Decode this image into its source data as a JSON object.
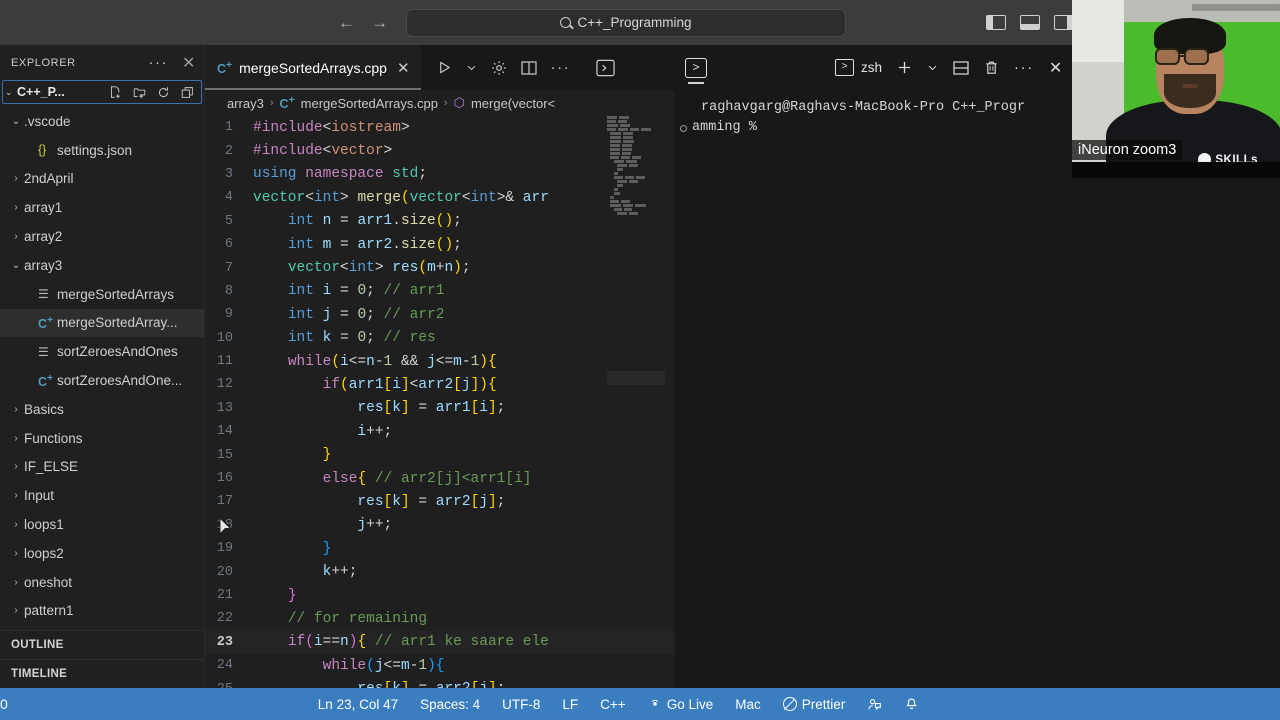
{
  "titlebar": {
    "back_icon": "←",
    "forward_icon": "→",
    "search_value": "C++_Programming",
    "search_icon": "search-icon",
    "layout_icons": [
      "toggle-primary-sidebar",
      "toggle-panel",
      "toggle-secondary-sidebar",
      "customize-layout"
    ]
  },
  "sidebar": {
    "title": "EXPLORER",
    "more_actions": "···",
    "close": "✕",
    "root": {
      "name": "C++_P...",
      "chevron": "⌄"
    },
    "root_actions": [
      "new-file",
      "new-folder",
      "refresh-explorer",
      "collapse-folders"
    ],
    "tree": [
      {
        "label": ".vscode",
        "indent": 0,
        "type": "folder",
        "open": true,
        "selected": false
      },
      {
        "label": "settings.json",
        "indent": 1,
        "type": "json",
        "open": false,
        "selected": false
      },
      {
        "label": "2ndApril",
        "indent": 0,
        "type": "folder",
        "open": false,
        "selected": false
      },
      {
        "label": "array1",
        "indent": 0,
        "type": "folder",
        "open": false,
        "selected": false
      },
      {
        "label": "array2",
        "indent": 0,
        "type": "folder",
        "open": false,
        "selected": false
      },
      {
        "label": "array3",
        "indent": 0,
        "type": "folder",
        "open": true,
        "selected": false
      },
      {
        "label": "mergeSortedArrays",
        "indent": 1,
        "type": "exe",
        "open": false,
        "selected": false
      },
      {
        "label": "mergeSortedArray...",
        "indent": 1,
        "type": "cpp",
        "open": false,
        "selected": true
      },
      {
        "label": "sortZeroesAndOnes",
        "indent": 1,
        "type": "exe",
        "open": false,
        "selected": false
      },
      {
        "label": "sortZeroesAndOne...",
        "indent": 1,
        "type": "cpp",
        "open": false,
        "selected": false
      },
      {
        "label": "Basics",
        "indent": 0,
        "type": "folder",
        "open": false,
        "selected": false
      },
      {
        "label": "Functions",
        "indent": 0,
        "type": "folder",
        "open": false,
        "selected": false
      },
      {
        "label": "IF_ELSE",
        "indent": 0,
        "type": "folder",
        "open": false,
        "selected": false
      },
      {
        "label": "Input",
        "indent": 0,
        "type": "folder",
        "open": false,
        "selected": false
      },
      {
        "label": "loops1",
        "indent": 0,
        "type": "folder",
        "open": false,
        "selected": false
      },
      {
        "label": "loops2",
        "indent": 0,
        "type": "folder",
        "open": false,
        "selected": false
      },
      {
        "label": "oneshot",
        "indent": 0,
        "type": "folder",
        "open": false,
        "selected": false
      },
      {
        "label": "pattern1",
        "indent": 0,
        "type": "folder",
        "open": false,
        "selected": false
      }
    ],
    "outline_label": "OUTLINE",
    "timeline_label": "TIMELINE"
  },
  "editor": {
    "tab": {
      "label": "mergeSortedArrays.cpp",
      "icon": "cpp-file-icon",
      "close": "✕"
    },
    "actions": [
      "run-code-button",
      "run-dropdown-chevron",
      "settings-gear-icon",
      "split-editor-icon",
      "more-actions-icon",
      "toggle-terminal-icon"
    ],
    "breadcrumb": [
      "array3",
      "mergeSortedArrays.cpp",
      "merge(vector<"
    ],
    "breadcrumb_separator": "›",
    "active_line": 23,
    "code": [
      {
        "n": 1,
        "tokens": [
          [
            "pre",
            "#include"
          ],
          [
            "op",
            "<"
          ],
          [
            "str",
            "iostream"
          ],
          [
            "op",
            ">"
          ]
        ]
      },
      {
        "n": 2,
        "tokens": [
          [
            "pre",
            "#include"
          ],
          [
            "op",
            "<"
          ],
          [
            "str",
            "vector"
          ],
          [
            "op",
            ">"
          ]
        ]
      },
      {
        "n": 3,
        "tokens": [
          [
            "kw",
            "using "
          ],
          [
            "ctl",
            "namespace "
          ],
          [
            "typ",
            "std"
          ],
          [
            "op",
            ";"
          ]
        ]
      },
      {
        "n": 4,
        "tokens": [
          [
            "typ",
            "vector"
          ],
          [
            "op",
            "<"
          ],
          [
            "kw",
            "int"
          ],
          [
            "op",
            "> "
          ],
          [
            "fn",
            "merge"
          ],
          [
            "p1",
            "("
          ],
          [
            "typ",
            "vector"
          ],
          [
            "op",
            "<"
          ],
          [
            "kw",
            "int"
          ],
          [
            "op",
            ">& "
          ],
          [
            "var",
            "arr"
          ]
        ]
      },
      {
        "n": 5,
        "tokens": [
          [
            "op",
            "    "
          ],
          [
            "kw",
            "int "
          ],
          [
            "var",
            "n"
          ],
          [
            "op",
            " = "
          ],
          [
            "var",
            "arr1"
          ],
          [
            "op",
            "."
          ],
          [
            "fn",
            "size"
          ],
          [
            "p1",
            "()"
          ],
          [
            "op",
            ";"
          ]
        ]
      },
      {
        "n": 6,
        "tokens": [
          [
            "op",
            "    "
          ],
          [
            "kw",
            "int "
          ],
          [
            "var",
            "m"
          ],
          [
            "op",
            " = "
          ],
          [
            "var",
            "arr2"
          ],
          [
            "op",
            "."
          ],
          [
            "fn",
            "size"
          ],
          [
            "p1",
            "()"
          ],
          [
            "op",
            ";"
          ]
        ]
      },
      {
        "n": 7,
        "tokens": [
          [
            "op",
            "    "
          ],
          [
            "typ",
            "vector"
          ],
          [
            "op",
            "<"
          ],
          [
            "kw",
            "int"
          ],
          [
            "op",
            "> "
          ],
          [
            "var",
            "res"
          ],
          [
            "p1",
            "("
          ],
          [
            "var",
            "m"
          ],
          [
            "op",
            "+"
          ],
          [
            "var",
            "n"
          ],
          [
            "p1",
            ")"
          ],
          [
            "op",
            ";"
          ]
        ]
      },
      {
        "n": 8,
        "tokens": [
          [
            "op",
            "    "
          ],
          [
            "kw",
            "int "
          ],
          [
            "var",
            "i"
          ],
          [
            "op",
            " = "
          ],
          [
            "num",
            "0"
          ],
          [
            "op",
            "; "
          ],
          [
            "cmt",
            "// arr1"
          ]
        ]
      },
      {
        "n": 9,
        "tokens": [
          [
            "op",
            "    "
          ],
          [
            "kw",
            "int "
          ],
          [
            "var",
            "j"
          ],
          [
            "op",
            " = "
          ],
          [
            "num",
            "0"
          ],
          [
            "op",
            "; "
          ],
          [
            "cmt",
            "// arr2"
          ]
        ]
      },
      {
        "n": 10,
        "tokens": [
          [
            "op",
            "    "
          ],
          [
            "kw",
            "int "
          ],
          [
            "var",
            "k"
          ],
          [
            "op",
            " = "
          ],
          [
            "num",
            "0"
          ],
          [
            "op",
            "; "
          ],
          [
            "cmt",
            "// res"
          ]
        ]
      },
      {
        "n": 11,
        "tokens": [
          [
            "op",
            "    "
          ],
          [
            "ctl",
            "while"
          ],
          [
            "p1",
            "("
          ],
          [
            "var",
            "i"
          ],
          [
            "op",
            "<="
          ],
          [
            "var",
            "n"
          ],
          [
            "op",
            "-"
          ],
          [
            "num",
            "1"
          ],
          [
            "op",
            " && "
          ],
          [
            "var",
            "j"
          ],
          [
            "op",
            "<="
          ],
          [
            "var",
            "m"
          ],
          [
            "op",
            "-"
          ],
          [
            "num",
            "1"
          ],
          [
            "p1",
            ")"
          ],
          [
            "p1",
            "{"
          ]
        ]
      },
      {
        "n": 12,
        "tokens": [
          [
            "op",
            "        "
          ],
          [
            "ctl",
            "if"
          ],
          [
            "p1",
            "("
          ],
          [
            "var",
            "arr1"
          ],
          [
            "p1",
            "["
          ],
          [
            "var",
            "i"
          ],
          [
            "p1",
            "]"
          ],
          [
            "op",
            "<"
          ],
          [
            "var",
            "arr2"
          ],
          [
            "p1",
            "["
          ],
          [
            "var",
            "j"
          ],
          [
            "p1",
            "]"
          ],
          [
            "p1",
            ")"
          ],
          [
            "p1",
            "{"
          ]
        ]
      },
      {
        "n": 13,
        "tokens": [
          [
            "op",
            "            "
          ],
          [
            "var",
            "res"
          ],
          [
            "p1",
            "["
          ],
          [
            "var",
            "k"
          ],
          [
            "p1",
            "]"
          ],
          [
            "op",
            " = "
          ],
          [
            "var",
            "arr1"
          ],
          [
            "p1",
            "["
          ],
          [
            "var",
            "i"
          ],
          [
            "p1",
            "]"
          ],
          [
            "op",
            ";"
          ]
        ]
      },
      {
        "n": 14,
        "tokens": [
          [
            "op",
            "            "
          ],
          [
            "var",
            "i"
          ],
          [
            "op",
            "++;"
          ]
        ]
      },
      {
        "n": 15,
        "tokens": [
          [
            "op",
            "        "
          ],
          [
            "p1",
            "}"
          ]
        ]
      },
      {
        "n": 16,
        "tokens": [
          [
            "op",
            "        "
          ],
          [
            "ctl",
            "else"
          ],
          [
            "p1",
            "{"
          ],
          [
            "op",
            " "
          ],
          [
            "cmt",
            "// arr2[j]<arr1[i]"
          ]
        ]
      },
      {
        "n": 17,
        "tokens": [
          [
            "op",
            "            "
          ],
          [
            "var",
            "res"
          ],
          [
            "p1",
            "["
          ],
          [
            "var",
            "k"
          ],
          [
            "p1",
            "]"
          ],
          [
            "op",
            " = "
          ],
          [
            "var",
            "arr2"
          ],
          [
            "p1",
            "["
          ],
          [
            "var",
            "j"
          ],
          [
            "p1",
            "]"
          ],
          [
            "op",
            ";"
          ]
        ]
      },
      {
        "n": 18,
        "tokens": [
          [
            "op",
            "            "
          ],
          [
            "var",
            "j"
          ],
          [
            "op",
            "++;"
          ]
        ]
      },
      {
        "n": 19,
        "tokens": [
          [
            "op",
            "        "
          ],
          [
            "p3",
            "}"
          ]
        ]
      },
      {
        "n": 20,
        "tokens": [
          [
            "op",
            "        "
          ],
          [
            "var",
            "k"
          ],
          [
            "op",
            "++;"
          ]
        ]
      },
      {
        "n": 21,
        "tokens": [
          [
            "op",
            "    "
          ],
          [
            "p2",
            "}"
          ]
        ]
      },
      {
        "n": 22,
        "tokens": [
          [
            "op",
            "    "
          ],
          [
            "cmt",
            "// for remaining"
          ]
        ]
      },
      {
        "n": 23,
        "tokens": [
          [
            "op",
            "    "
          ],
          [
            "ctl",
            "if"
          ],
          [
            "p2",
            "("
          ],
          [
            "var",
            "i"
          ],
          [
            "op",
            "=="
          ],
          [
            "var",
            "n"
          ],
          [
            "p2",
            ")"
          ],
          [
            "p1",
            "{"
          ],
          [
            "op",
            " "
          ],
          [
            "cmt",
            "// arr1 ke saare ele"
          ]
        ]
      },
      {
        "n": 24,
        "tokens": [
          [
            "op",
            "        "
          ],
          [
            "ctl",
            "while"
          ],
          [
            "p3",
            "("
          ],
          [
            "var",
            "j"
          ],
          [
            "op",
            "<="
          ],
          [
            "var",
            "m"
          ],
          [
            "op",
            "-"
          ],
          [
            "num",
            "1"
          ],
          [
            "p3",
            ")"
          ],
          [
            "p3",
            "{"
          ]
        ]
      },
      {
        "n": 25,
        "tokens": [
          [
            "op",
            "            "
          ],
          [
            "var",
            "res"
          ],
          [
            "p1",
            "["
          ],
          [
            "var",
            "k"
          ],
          [
            "p1",
            "]"
          ],
          [
            "op",
            " = "
          ],
          [
            "var",
            "arr2"
          ],
          [
            "p1",
            "["
          ],
          [
            "var",
            "j"
          ],
          [
            "p1",
            "]"
          ],
          [
            "op",
            ";"
          ]
        ]
      }
    ]
  },
  "panel": {
    "tab_icon": "terminal-icon",
    "shell_name": "zsh",
    "actions": [
      "new-terminal-plus",
      "terminal-profile-chevron",
      "split-terminal-icon",
      "kill-terminal-icon",
      "more-actions-icon",
      "close-panel-icon"
    ],
    "terminal_lines": [
      "raghavgarg@Raghavs-MacBook-Pro C++_Progr",
      "amming %"
    ]
  },
  "statusbar": {
    "left_text": "0",
    "items": [
      {
        "label": "Ln 23, Col 47",
        "icon": null
      },
      {
        "label": "Spaces: 4",
        "icon": null
      },
      {
        "label": "UTF-8",
        "icon": null
      },
      {
        "label": "LF",
        "icon": null
      },
      {
        "label": "C++",
        "icon": null
      },
      {
        "label": "Go Live",
        "icon": "broadcast-icon"
      },
      {
        "label": "Mac",
        "icon": null
      },
      {
        "label": "Prettier",
        "icon": "circle-slash-icon"
      }
    ],
    "feedback_icon": "feedback-icon",
    "bell_icon": "🔔",
    "accent_color": "#3a7ebf"
  },
  "webcam": {
    "label": "iNeuron zoom3",
    "logo_text": "SKILLs"
  }
}
